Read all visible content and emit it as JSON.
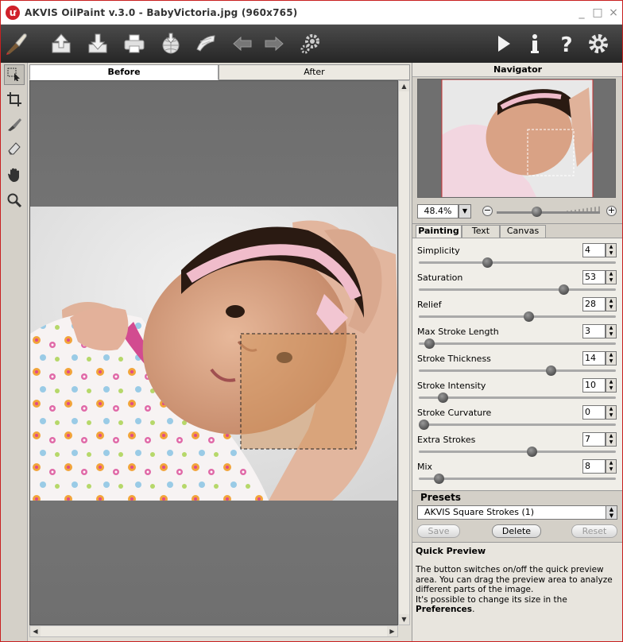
{
  "window": {
    "title": "AKVIS OilPaint v.3.0 - BabyVictoria.jpg (960x765)",
    "app_icon": "akvis-logo-icon",
    "controls": {
      "minimize": "_",
      "maximize": "□",
      "close": "×"
    }
  },
  "toolbar": {
    "left_buttons": [
      {
        "name": "oilpaint-brush-logo-icon"
      },
      {
        "name": "open-image-icon"
      },
      {
        "name": "save-image-icon"
      },
      {
        "name": "print-icon"
      },
      {
        "name": "publish-icon"
      },
      {
        "name": "share-icon"
      },
      {
        "name": "undo-arrow-icon"
      },
      {
        "name": "redo-arrow-icon"
      },
      {
        "name": "batch-settings-icon"
      }
    ],
    "right_buttons": [
      {
        "name": "run-play-icon"
      },
      {
        "name": "info-icon"
      },
      {
        "name": "help-icon"
      },
      {
        "name": "preferences-gear-icon"
      }
    ]
  },
  "tools": [
    {
      "name": "before-after-tool-icon",
      "active": true
    },
    {
      "name": "crop-tool-icon",
      "active": false
    },
    {
      "name": "decoration-brush-tool-icon",
      "active": false
    },
    {
      "name": "eraser-tool-icon",
      "active": false
    },
    {
      "name": "hand-tool-icon",
      "active": false
    },
    {
      "name": "zoom-tool-icon",
      "active": false
    }
  ],
  "image_tabs": {
    "before": "Before",
    "after": "After",
    "active": "Before"
  },
  "navigator": {
    "title": "Navigator",
    "zoom": "48.4%",
    "zoom_minus": "−",
    "zoom_plus": "+",
    "zoom_level": 0.38
  },
  "settings_tabs": [
    "Painting",
    "Text",
    "Canvas"
  ],
  "active_settings_tab": "Painting",
  "params": [
    {
      "label": "Simplicity",
      "value": "4",
      "level": 0.34
    },
    {
      "label": "Saturation",
      "value": "53",
      "level": 0.75
    },
    {
      "label": "Relief",
      "value": "28",
      "level": 0.56
    },
    {
      "label": "Max Stroke Length",
      "value": "3",
      "level": 0.03
    },
    {
      "label": "Stroke Thickness",
      "value": "14",
      "level": 0.68
    },
    {
      "label": "Stroke Intensity",
      "value": "10",
      "level": 0.1
    },
    {
      "label": "Stroke Curvature",
      "value": "0",
      "level": 0.0
    },
    {
      "label": "Extra Strokes",
      "value": "7",
      "level": 0.58
    },
    {
      "label": "Mix",
      "value": "8",
      "level": 0.08
    }
  ],
  "presets": {
    "title": "Presets",
    "selected": "AKVIS Square Strokes (1)",
    "save": "Save",
    "delete": "Delete",
    "reset": "Reset"
  },
  "quick_preview": {
    "title": "Quick Preview",
    "text": "The button switches on/off the quick preview area. You can drag the preview area to analyze different parts of the image.",
    "text2_prefix": "It's possible to change its size in the ",
    "text2_bold": "Preferences",
    "text2_suffix": "."
  }
}
